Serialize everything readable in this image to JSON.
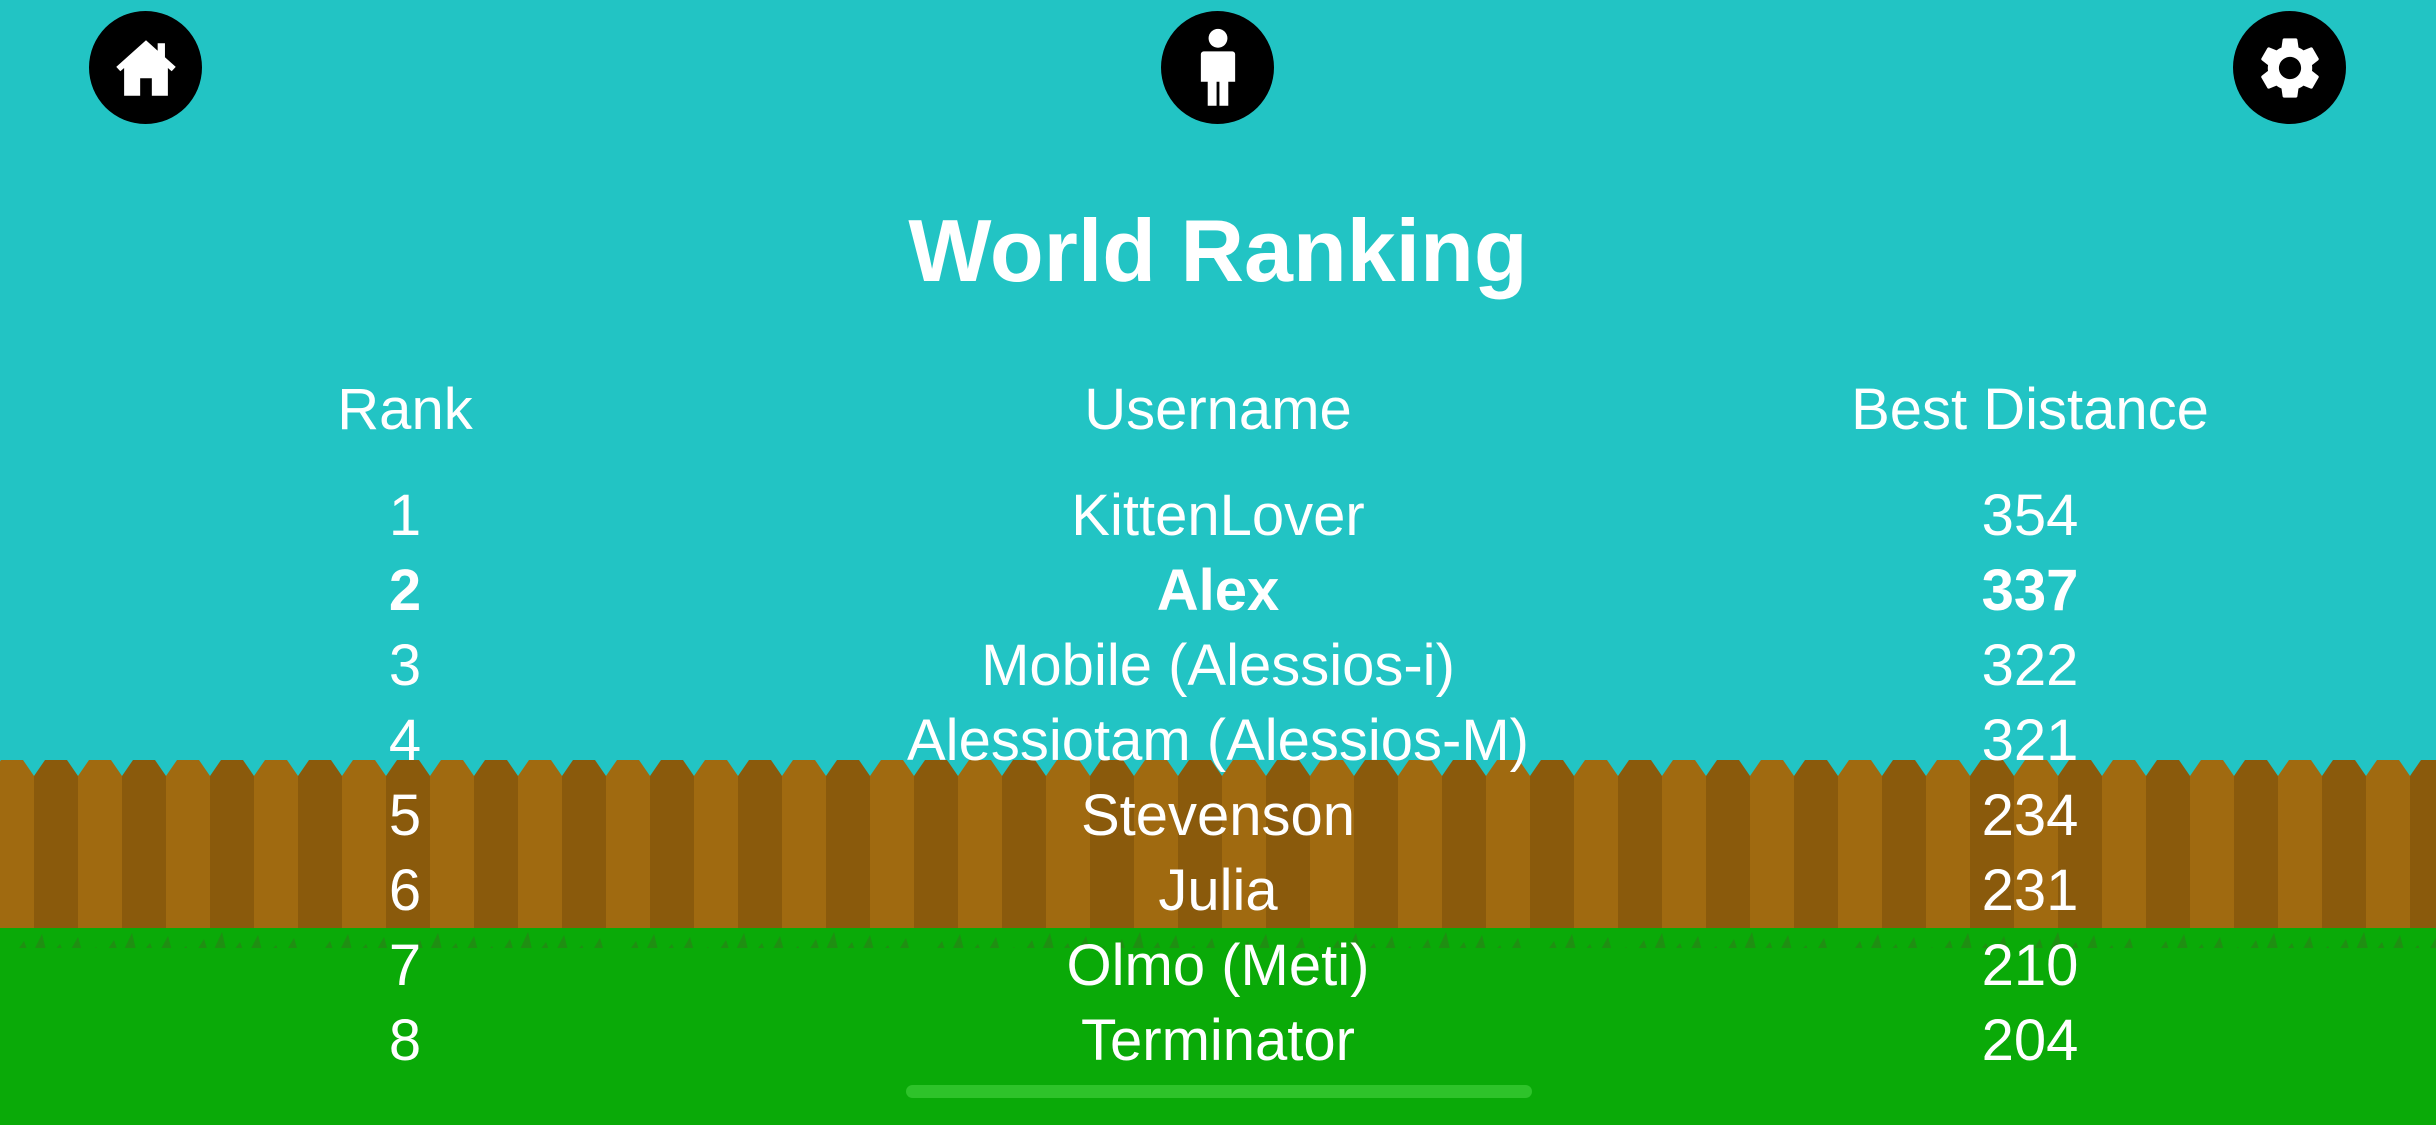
{
  "screen": {
    "title": "World Ranking"
  },
  "toolbar": {
    "home_icon": "home-icon",
    "profile_icon": "person-icon",
    "settings_icon": "gear-icon"
  },
  "ranking": {
    "headers": {
      "rank": "Rank",
      "username": "Username",
      "distance": "Best Distance"
    },
    "rows": [
      {
        "rank": "1",
        "username": "KittenLover",
        "distance": "354",
        "current": false
      },
      {
        "rank": "2",
        "username": "Alex",
        "distance": "337",
        "current": true
      },
      {
        "rank": "3",
        "username": "Mobile (Alessios-i)",
        "distance": "322",
        "current": false
      },
      {
        "rank": "4",
        "username": "Alessiotam (Alessios-M)",
        "distance": "321",
        "current": false
      },
      {
        "rank": "5",
        "username": "Stevenson",
        "distance": "234",
        "current": false
      },
      {
        "rank": "6",
        "username": "Julia",
        "distance": "231",
        "current": false
      },
      {
        "rank": "7",
        "username": "Olmo (Meti)",
        "distance": "210",
        "current": false
      },
      {
        "rank": "8",
        "username": "Terminator",
        "distance": "204",
        "current": false
      }
    ]
  },
  "colors": {
    "sky": "#22c4c4",
    "fence_light": "#a06a10",
    "fence_dark": "#8a5a0c",
    "grass": "#0aaa08",
    "text": "#ffffff",
    "button": "#000000"
  }
}
